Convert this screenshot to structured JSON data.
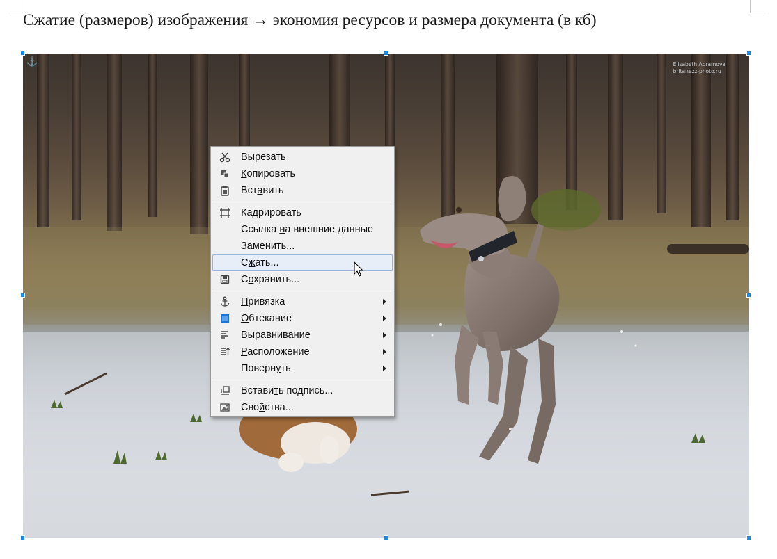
{
  "document": {
    "heading": "Сжатие (размеров) изображения → экономия ресурсов и размера документа (в кб)"
  },
  "image": {
    "watermark_line1": "Elisabeth Abramova",
    "watermark_line2": "britanezz-photo.ru"
  },
  "context_menu": {
    "items": [
      {
        "pre": "",
        "u": "В",
        "post": "ырезать",
        "icon": "scissors-icon",
        "submenu": false
      },
      {
        "pre": "",
        "u": "К",
        "post": "опировать",
        "icon": "copy-icon",
        "submenu": false
      },
      {
        "pre": "Вст",
        "u": "а",
        "post": "вить",
        "icon": "paste-icon",
        "submenu": false
      },
      {
        "pre": "Ка",
        "u": "д",
        "post": "рировать",
        "icon": "crop-icon",
        "submenu": false
      },
      {
        "pre": "Ссылка ",
        "u": "н",
        "post": "а внешние данные",
        "icon": "",
        "submenu": false
      },
      {
        "pre": "",
        "u": "З",
        "post": "аменить...",
        "icon": "",
        "submenu": false
      },
      {
        "pre": "С",
        "u": "ж",
        "post": "ать...",
        "icon": "",
        "submenu": false
      },
      {
        "pre": "С",
        "u": "о",
        "post": "хранить...",
        "icon": "save-icon",
        "submenu": false
      },
      {
        "pre": "",
        "u": "П",
        "post": "ривязка",
        "icon": "anchor-icon",
        "submenu": true
      },
      {
        "pre": "",
        "u": "О",
        "post": "бтекание",
        "icon": "wrap-icon",
        "submenu": true
      },
      {
        "pre": "В",
        "u": "ы",
        "post": "равнивание",
        "icon": "align-icon",
        "submenu": true
      },
      {
        "pre": "",
        "u": "Р",
        "post": "асположение",
        "icon": "arrange-icon",
        "submenu": true
      },
      {
        "pre": "Поверн",
        "u": "у",
        "post": "ть",
        "icon": "",
        "submenu": true
      },
      {
        "pre": "Встави",
        "u": "т",
        "post": "ь подпись...",
        "icon": "caption-icon",
        "submenu": false
      },
      {
        "pre": "Сво",
        "u": "й",
        "post": "ства...",
        "icon": "properties-icon",
        "submenu": false
      }
    ],
    "highlighted_item": "Сжать..."
  },
  "colors": {
    "selection_handle": "#1e88e5",
    "menu_background": "#f0f0f0",
    "menu_highlight": "#e8eef7"
  }
}
